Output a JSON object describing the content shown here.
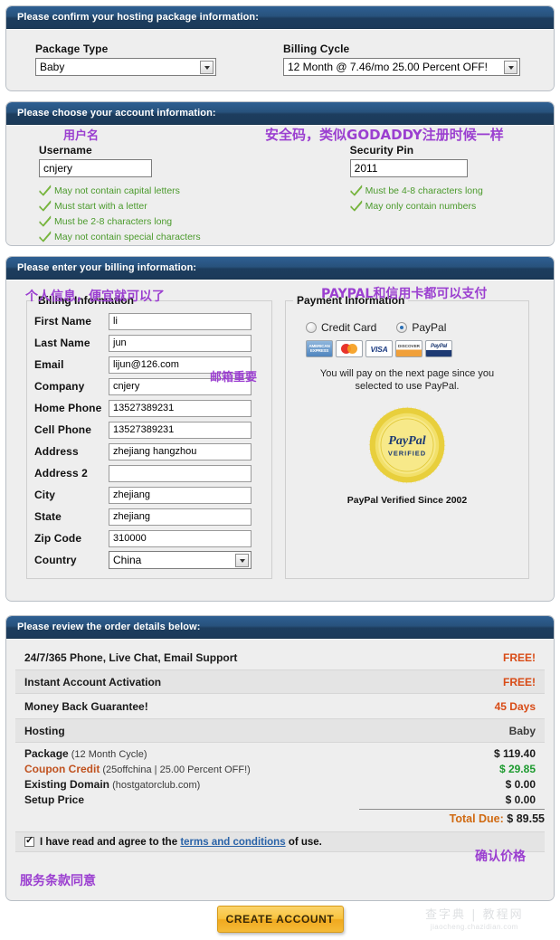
{
  "package_section": {
    "header": "Please confirm your hosting package information:",
    "package_type_label": "Package Type",
    "package_type_value": "Baby",
    "billing_cycle_label": "Billing Cycle",
    "billing_cycle_value": "12 Month @ 7.46/mo 25.00 Percent OFF!"
  },
  "account_section": {
    "header": "Please choose your account information:",
    "username_label": "Username",
    "username_value": "cnjery",
    "username_rules": [
      "May not contain capital letters",
      "Must start with a letter",
      "Must be 2-8 characters long",
      "May not contain special characters"
    ],
    "pin_label": "Security Pin",
    "pin_value": "2011",
    "pin_rules": [
      "Must be 4-8 characters long",
      "May only contain numbers"
    ]
  },
  "billing_section": {
    "header": "Please enter your billing information:",
    "billing_legend": "Billing Information",
    "fields": [
      {
        "label": "First Name",
        "value": "li",
        "type": "text"
      },
      {
        "label": "Last Name",
        "value": "jun",
        "type": "text"
      },
      {
        "label": "Email",
        "value": "lijun@126.com",
        "type": "text"
      },
      {
        "label": "Company",
        "value": "cnjery",
        "type": "text"
      },
      {
        "label": "Home Phone",
        "value": "13527389231",
        "type": "text"
      },
      {
        "label": "Cell Phone",
        "value": "13527389231",
        "type": "text"
      },
      {
        "label": "Address",
        "value": "zhejiang hangzhou",
        "type": "text"
      },
      {
        "label": "Address 2",
        "value": "",
        "type": "text"
      },
      {
        "label": "City",
        "value": "zhejiang",
        "type": "text"
      },
      {
        "label": "State",
        "value": "zhejiang",
        "type": "text"
      },
      {
        "label": "Zip Code",
        "value": "310000",
        "type": "text"
      },
      {
        "label": "Country",
        "value": "China",
        "type": "select"
      }
    ],
    "payment_legend": "Payment Information",
    "payment_options": [
      {
        "label": "Credit Card",
        "selected": false
      },
      {
        "label": "PayPal",
        "selected": true
      }
    ],
    "card_icons": [
      "amex-card-icon",
      "mastercard-card-icon",
      "visa-card-icon",
      "discover-card-icon",
      "paypal-card-icon"
    ],
    "card_labels": [
      "AMERICAN EXPRESS",
      "",
      "VISA",
      "DISCOVER",
      "PayPal"
    ],
    "payment_note": "You will pay on the next page since you selected to use PayPal.",
    "seal_top": "PayPal",
    "seal_bottom": "VERIFIED",
    "seal_caption": "PayPal Verified Since 2002"
  },
  "order_section": {
    "header": "Please review the order details below:",
    "feature_rows": [
      {
        "label": "24/7/365 Phone, Live Chat, Email Support",
        "value": "FREE!",
        "style": "free"
      },
      {
        "label": "Instant Account Activation",
        "value": "FREE!",
        "style": "free"
      },
      {
        "label": "Money Back Guarantee!",
        "value": "45 Days",
        "style": "days"
      },
      {
        "label": "Hosting",
        "value": "Baby",
        "style": "plain"
      }
    ],
    "price_rows": [
      {
        "name": "Package",
        "detail": "(12 Month Cycle)",
        "amount": "$ 119.40",
        "amount_color": "dark",
        "name_color": "dark"
      },
      {
        "name": "Coupon Credit",
        "detail": "(25offchina | 25.00 Percent OFF!)",
        "amount": "$ 29.85",
        "amount_color": "green",
        "name_color": "orange"
      },
      {
        "name": "Existing Domain",
        "detail": "(hostgatorclub.com)",
        "amount": "$ 0.00",
        "amount_color": "dark",
        "name_color": "dark"
      },
      {
        "name": "Setup Price",
        "detail": "",
        "amount": "$ 0.00",
        "amount_color": "dark",
        "name_color": "dark"
      }
    ],
    "total_label": "Total Due:",
    "total_amount": "$ 89.55",
    "terms_pre": "I have read and agree to the",
    "terms_link": "terms and conditions",
    "terms_post": "of use.",
    "terms_checked": true
  },
  "submit": {
    "label": "CREATE ACCOUNT"
  },
  "annotations": {
    "username": "用户名",
    "security_pin": "安全码，类似GODADDY注册时候一样",
    "personal_info": "个人信息，便宜就可以了",
    "payment": "PAYPAL和信用卡都可以支付",
    "email": "邮箱重要",
    "confirm_price": "确认价格",
    "terms_agree": "服务条款同意"
  },
  "watermark": {
    "line1": "查字典 | 教程网",
    "line2": "jiaocheng.chazidian.com"
  },
  "colors": {
    "panel_header_blue": "#28527c",
    "accent_orange": "#d84b16",
    "valid_green": "#4b9a2c",
    "annotation_purple": "#9b3fd0",
    "link_blue": "#2a63a8",
    "total_orange": "#d06a12",
    "button_gold": "#f8c43f"
  }
}
